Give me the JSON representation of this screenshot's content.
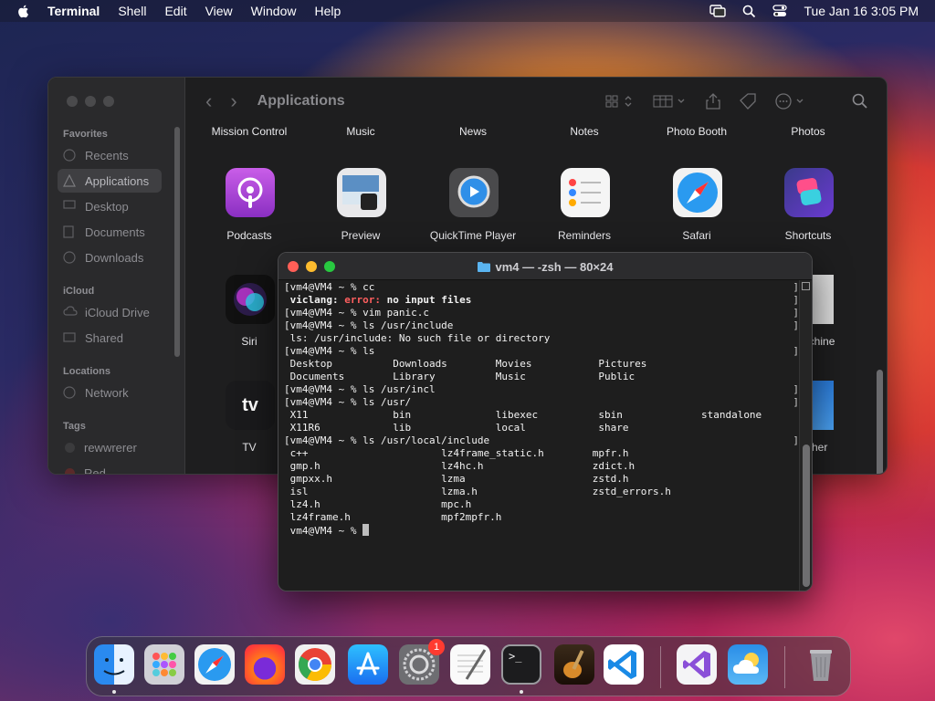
{
  "menubar": {
    "app_name": "Terminal",
    "items": [
      "Shell",
      "Edit",
      "View",
      "Window",
      "Help"
    ],
    "datetime": "Tue Jan 16  3:05 PM"
  },
  "finder": {
    "title": "Applications",
    "sidebar": {
      "favorites_header": "Favorites",
      "favorites": [
        "Recents",
        "Applications",
        "Desktop",
        "Documents",
        "Downloads"
      ],
      "icloud_header": "iCloud",
      "icloud": [
        "iCloud Drive",
        "Shared"
      ],
      "locations_header": "Locations",
      "locations": [
        "Network"
      ],
      "tags_header": "Tags",
      "tags": [
        "rewwrerer",
        "Red"
      ]
    },
    "apps_row0": [
      "Mission Control",
      "Music",
      "News",
      "Notes",
      "Photo Booth",
      "Photos"
    ],
    "apps_row1": [
      "Podcasts",
      "Preview",
      "QuickTime Player",
      "Reminders",
      "Safari",
      "Shortcuts"
    ],
    "apps_row2": [
      "Siri",
      "",
      "",
      "",
      "",
      "Time Machine"
    ],
    "apps_row2_partial": "nchine",
    "apps_row3": [
      "TV",
      "",
      "",
      "",
      "",
      "Weather"
    ],
    "apps_row3_partial": "her",
    "tv_icon_text": "tv"
  },
  "terminal": {
    "title": "vm4 — -zsh — 80×24",
    "lines": [
      {
        "prefix": "[vm4@VM4 ~ % cc",
        "rest": ""
      },
      {
        "prefix": " viclang: ",
        "err": "error:",
        "rest": " no input files",
        "bold": true
      },
      {
        "prefix": "[vm4@VM4 ~ % vim panic.c",
        "rest": ""
      },
      {
        "prefix": "[vm4@VM4 ~ % ls /usr/include",
        "rest": ""
      },
      {
        "prefix": " ls: /usr/include: No such file or directory",
        "rest": ""
      },
      {
        "prefix": "[vm4@VM4 ~ % ls",
        "rest": ""
      },
      {
        "prefix": " Desktop          Downloads        Movies           Pictures",
        "rest": ""
      },
      {
        "prefix": " Documents        Library          Music            Public",
        "rest": ""
      },
      {
        "prefix": "[vm4@VM4 ~ % ls /usr/incl",
        "rest": ""
      },
      {
        "prefix": "[vm4@VM4 ~ % ls /usr/",
        "rest": ""
      },
      {
        "prefix": " X11              bin              libexec          sbin             standalone",
        "rest": ""
      },
      {
        "prefix": " X11R6            lib              local            share",
        "rest": ""
      },
      {
        "prefix": "[vm4@VM4 ~ % ls /usr/local/include",
        "rest": ""
      },
      {
        "prefix": " c++                      lz4frame_static.h        mpfr.h",
        "rest": ""
      },
      {
        "prefix": " gmp.h                    lz4hc.h                  zdict.h",
        "rest": ""
      },
      {
        "prefix": " gmpxx.h                  lzma                     zstd.h",
        "rest": ""
      },
      {
        "prefix": " isl                      lzma.h                   zstd_errors.h",
        "rest": ""
      },
      {
        "prefix": " lz4.h                    mpc.h",
        "rest": ""
      },
      {
        "prefix": " lz4frame.h               mpf2mpfr.h",
        "rest": ""
      },
      {
        "prefix": " vm4@VM4 ~ % ",
        "rest": "",
        "cursor": true
      }
    ],
    "right_brackets": [
      "]",
      "]",
      "]",
      "]",
      "]",
      "]",
      "]",
      "]"
    ]
  },
  "dock": {
    "items": [
      "finder-icon",
      "launchpad-icon",
      "safari-icon",
      "firefox-icon",
      "chrome-icon",
      "app-store-icon",
      "system-settings-icon",
      "textedit-icon",
      "terminal-icon",
      "garageband-icon",
      "vscode-icon",
      "visual-studio-icon",
      "weather-icon",
      "trash-icon"
    ],
    "settings_badge": "1",
    "terminal_glyph": ">_"
  },
  "colors": {
    "error_red": "#ff5f5f",
    "close": "#ff5f57",
    "minimize": "#febc2e",
    "zoom": "#28c840"
  }
}
